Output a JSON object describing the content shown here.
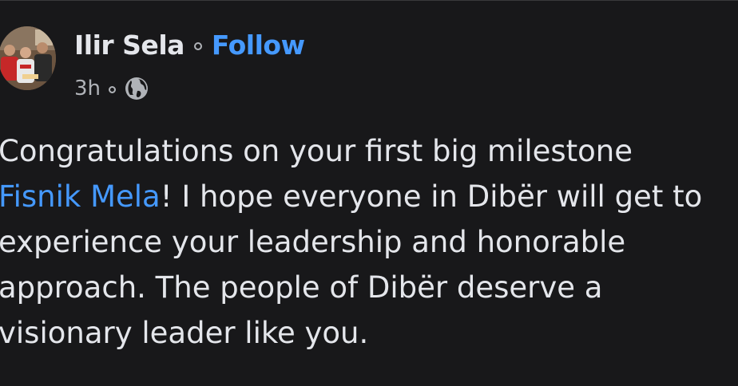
{
  "post": {
    "author": "Ilir Sela",
    "follow_label": "Follow",
    "timestamp": "3h",
    "audience_icon": "globe-icon",
    "text_line_1": "Congratulations on your first big milestone",
    "mention": "Fisnik Mela",
    "text_line_2_rest": "! I hope everyone in Dibër will get to",
    "text_line_3": "experience your leadership and honorable",
    "text_line_4": "approach. The people of Dibër deserve a",
    "text_line_5": "visionary leader like you."
  },
  "colors": {
    "background": "#18181a",
    "text": "#e4e6eb",
    "secondary_text": "#b0b3b8",
    "link": "#4599ff"
  }
}
